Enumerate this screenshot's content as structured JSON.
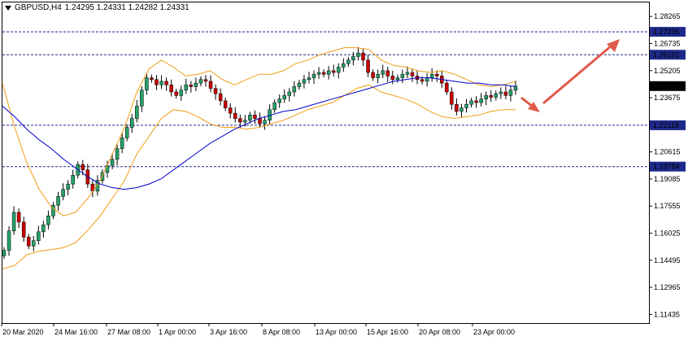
{
  "window": {
    "symbol_tf": "GBPUSD,H4",
    "ohlc": "1.24295 1.24331 1.24282 1.24331"
  },
  "colors": {
    "bull": "#26a269",
    "bear": "#cc0000",
    "wick": "#000000",
    "ma": "#0000cc",
    "band": "#f39c12",
    "hline": "#1e2a8a",
    "arrow": "#e05a4a",
    "price_tag_bg": "#000000",
    "price_tag_fg": "#ffffff",
    "level_tag_bg": "#1e2a8a"
  },
  "chart_data": {
    "type": "candlestick",
    "yaxis": {
      "ticks": [
        "1.28265",
        "1.26735",
        "1.25205",
        "1.23675",
        "1.22145",
        "1.20615",
        "1.19085",
        "1.17555",
        "1.16025",
        "1.14495",
        "1.12965",
        "1.11435"
      ],
      "range": [
        1.10945,
        1.29055
      ]
    },
    "xaxis": {
      "ticks": [
        "20 Mar 2020",
        "24 Mar 16:00",
        "27 Mar 08:00",
        "1 Apr 00:00",
        "3 Apr 16:00",
        "8 Apr 08:00",
        "13 Apr 00:00",
        "15 Apr 16:00",
        "20 Apr 08:00",
        "23 Apr 00:00"
      ]
    },
    "levels": [
      "1.27396",
      "1.26101",
      "1.22118",
      "1.19784"
    ],
    "current_price": "1.24331",
    "closes": [
      1.1505,
      1.1615,
      1.172,
      1.1665,
      1.158,
      1.153,
      1.156,
      1.161,
      1.165,
      1.17,
      1.176,
      1.181,
      1.185,
      1.188,
      1.193,
      1.199,
      1.196,
      1.188,
      1.184,
      1.19,
      1.1945,
      1.1985,
      1.202,
      1.208,
      1.214,
      1.22,
      1.225,
      1.232,
      1.241,
      1.248,
      1.247,
      1.244,
      1.246,
      1.244,
      1.24,
      1.238,
      1.241,
      1.244,
      1.243,
      1.245,
      1.247,
      1.246,
      1.242,
      1.239,
      1.235,
      1.231,
      1.228,
      1.225,
      1.223,
      1.224,
      1.227,
      1.225,
      1.222,
      1.224,
      1.23,
      1.234,
      1.236,
      1.238,
      1.24,
      1.243,
      1.245,
      1.247,
      1.248,
      1.25,
      1.251,
      1.25,
      1.252,
      1.251,
      1.254,
      1.256,
      1.258,
      1.26,
      1.262,
      1.258,
      1.251,
      1.248,
      1.25,
      1.252,
      1.249,
      1.247,
      1.248,
      1.25,
      1.251,
      1.249,
      1.247,
      1.246,
      1.248,
      1.25,
      1.249,
      1.245,
      1.24,
      1.233,
      1.229,
      1.231,
      1.233,
      1.235,
      1.234,
      1.236,
      1.238,
      1.237,
      1.239,
      1.24,
      1.238,
      1.241,
      1.2433
    ],
    "ma_values": [
      1.232,
      1.226,
      1.219,
      1.213,
      1.208,
      1.202,
      1.197,
      1.192,
      1.188,
      1.186,
      1.185,
      1.186,
      1.188,
      1.191,
      1.196,
      1.201,
      1.206,
      1.211,
      1.215,
      1.219,
      1.222,
      1.225,
      1.227,
      1.229,
      1.23,
      1.232,
      1.234,
      1.236,
      1.238,
      1.24,
      1.242,
      1.244,
      1.246,
      1.247,
      1.248,
      1.248,
      1.247,
      1.246,
      1.245,
      1.245,
      1.244,
      1.244,
      1.243
    ],
    "bb_upper": [
      1.245,
      1.22,
      1.2,
      1.185,
      1.175,
      1.17,
      1.172,
      1.18,
      1.19,
      1.205,
      1.22,
      1.24,
      1.253,
      1.258,
      1.254,
      1.249,
      1.25,
      1.252,
      1.247,
      1.244,
      1.247,
      1.25,
      1.25,
      1.252,
      1.256,
      1.258,
      1.261,
      1.263,
      1.265,
      1.265,
      1.264,
      1.258,
      1.255,
      1.254,
      1.252,
      1.251,
      1.252,
      1.25,
      1.247,
      1.244,
      1.243,
      1.244,
      1.246
    ],
    "bb_lower": [
      1.14,
      1.142,
      1.148,
      1.15,
      1.151,
      1.152,
      1.155,
      1.162,
      1.17,
      1.18,
      1.19,
      1.205,
      1.215,
      1.225,
      1.23,
      1.229,
      1.226,
      1.222,
      1.22,
      1.22,
      1.219,
      1.22,
      1.222,
      1.224,
      1.227,
      1.23,
      1.232,
      1.234,
      1.238,
      1.242,
      1.244,
      1.24,
      1.238,
      1.236,
      1.233,
      1.229,
      1.226,
      1.225,
      1.226,
      1.227,
      1.229,
      1.23,
      1.23
    ]
  }
}
